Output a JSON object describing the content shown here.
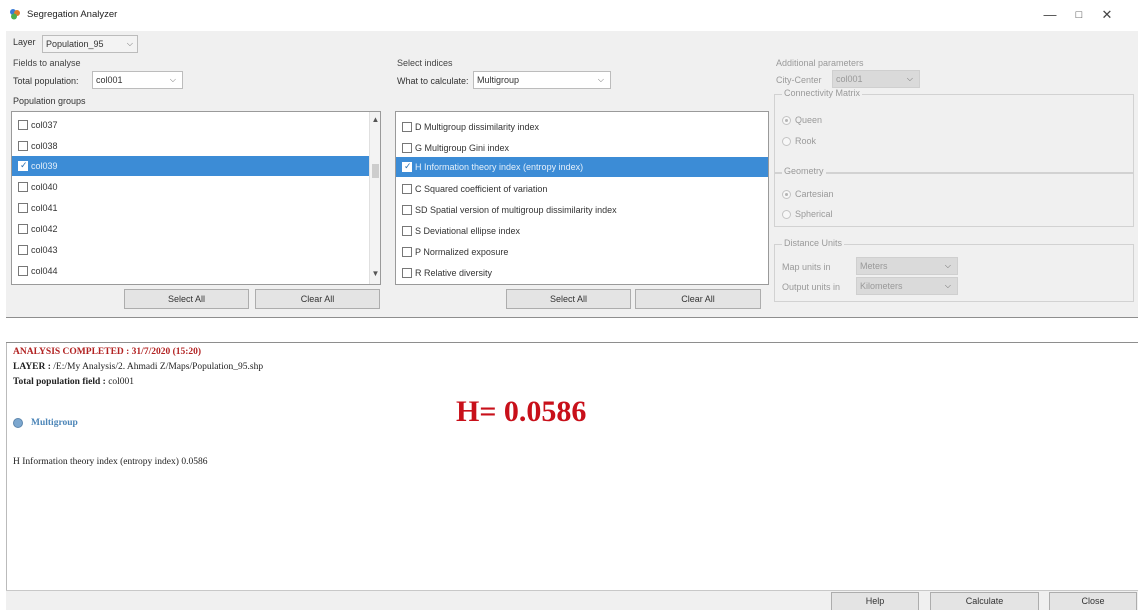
{
  "window": {
    "title": "Segregation Analyzer",
    "minimize": "—",
    "maximize": "□",
    "close": "✕"
  },
  "layer": {
    "label": "Layer",
    "value": "Population_95"
  },
  "fields": {
    "title": "Fields to analyse",
    "total_label": "Total population:",
    "total_value": "col001",
    "groups_label": "Population groups",
    "items": [
      {
        "label": "col037",
        "checked": false
      },
      {
        "label": "col038",
        "checked": false
      },
      {
        "label": "col039",
        "checked": true
      },
      {
        "label": "col040",
        "checked": false
      },
      {
        "label": "col041",
        "checked": false
      },
      {
        "label": "col042",
        "checked": false
      },
      {
        "label": "col043",
        "checked": false
      },
      {
        "label": "col044",
        "checked": false
      }
    ],
    "select_all": "Select All",
    "clear_all": "Clear All"
  },
  "indices": {
    "title": "Select indices",
    "calc_label": "What to calculate:",
    "calc_value": "Multigroup",
    "items": [
      {
        "label": "D Multigroup dissimilarity index",
        "checked": false
      },
      {
        "label": "G Multigroup Gini index",
        "checked": false
      },
      {
        "label": "H Information theory index (entropy index)",
        "checked": true
      },
      {
        "label": "C Squared coefficient of variation",
        "checked": false
      },
      {
        "label": "SD Spatial version of multigroup dissimilarity index",
        "checked": false
      },
      {
        "label": "S Deviational ellipse index",
        "checked": false
      },
      {
        "label": "P Normalized exposure",
        "checked": false
      },
      {
        "label": "R Relative diversity",
        "checked": false
      }
    ],
    "select_all": "Select All",
    "clear_all": "Clear All"
  },
  "additional": {
    "title": "Additional parameters",
    "city_center_label": "City-Center",
    "city_center_value": "col001",
    "connectivity_title": "Connectivity Matrix",
    "queen": "Queen",
    "rook": "Rook",
    "geometry_title": "Geometry",
    "cartesian": "Cartesian",
    "spherical": "Spherical",
    "distance_title": "Distance Units",
    "map_units_label": "Map units in",
    "map_units_value": "Meters",
    "output_units_label": "Output units in",
    "output_units_value": "Kilometers"
  },
  "output": {
    "completed": "ANALYSIS COMPLETED : 31/7/2020 (15:20)",
    "layer_key": "LAYER :",
    "layer_path": " /E:/My Analysis/2. Ahmadi Z/Maps/Population_95.shp",
    "total_key": "Total population field :",
    "total_val": " col001",
    "section": "Multigroup",
    "result_line": "H Information theory index (entropy index)  0.0586",
    "big_result": "H= 0.0586"
  },
  "footer": {
    "help": "Help",
    "calculate": "Calculate",
    "close": "Close"
  }
}
